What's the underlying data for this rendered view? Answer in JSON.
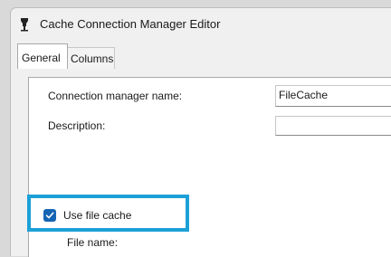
{
  "window": {
    "title": "Cache Connection Manager Editor",
    "icon": "cache-icon"
  },
  "tabs": [
    {
      "label": "General",
      "active": true
    },
    {
      "label": "Columns",
      "active": false
    }
  ],
  "general": {
    "connection_name_label": "Connection manager name:",
    "connection_name_value": "FileCache",
    "description_label": "Description:",
    "description_value": "",
    "use_file_cache_label": "Use file cache",
    "use_file_cache_checked": true,
    "file_name_label": "File name:"
  },
  "colors": {
    "highlight": "#1ca0d8",
    "checkbox": "#1565b4"
  }
}
